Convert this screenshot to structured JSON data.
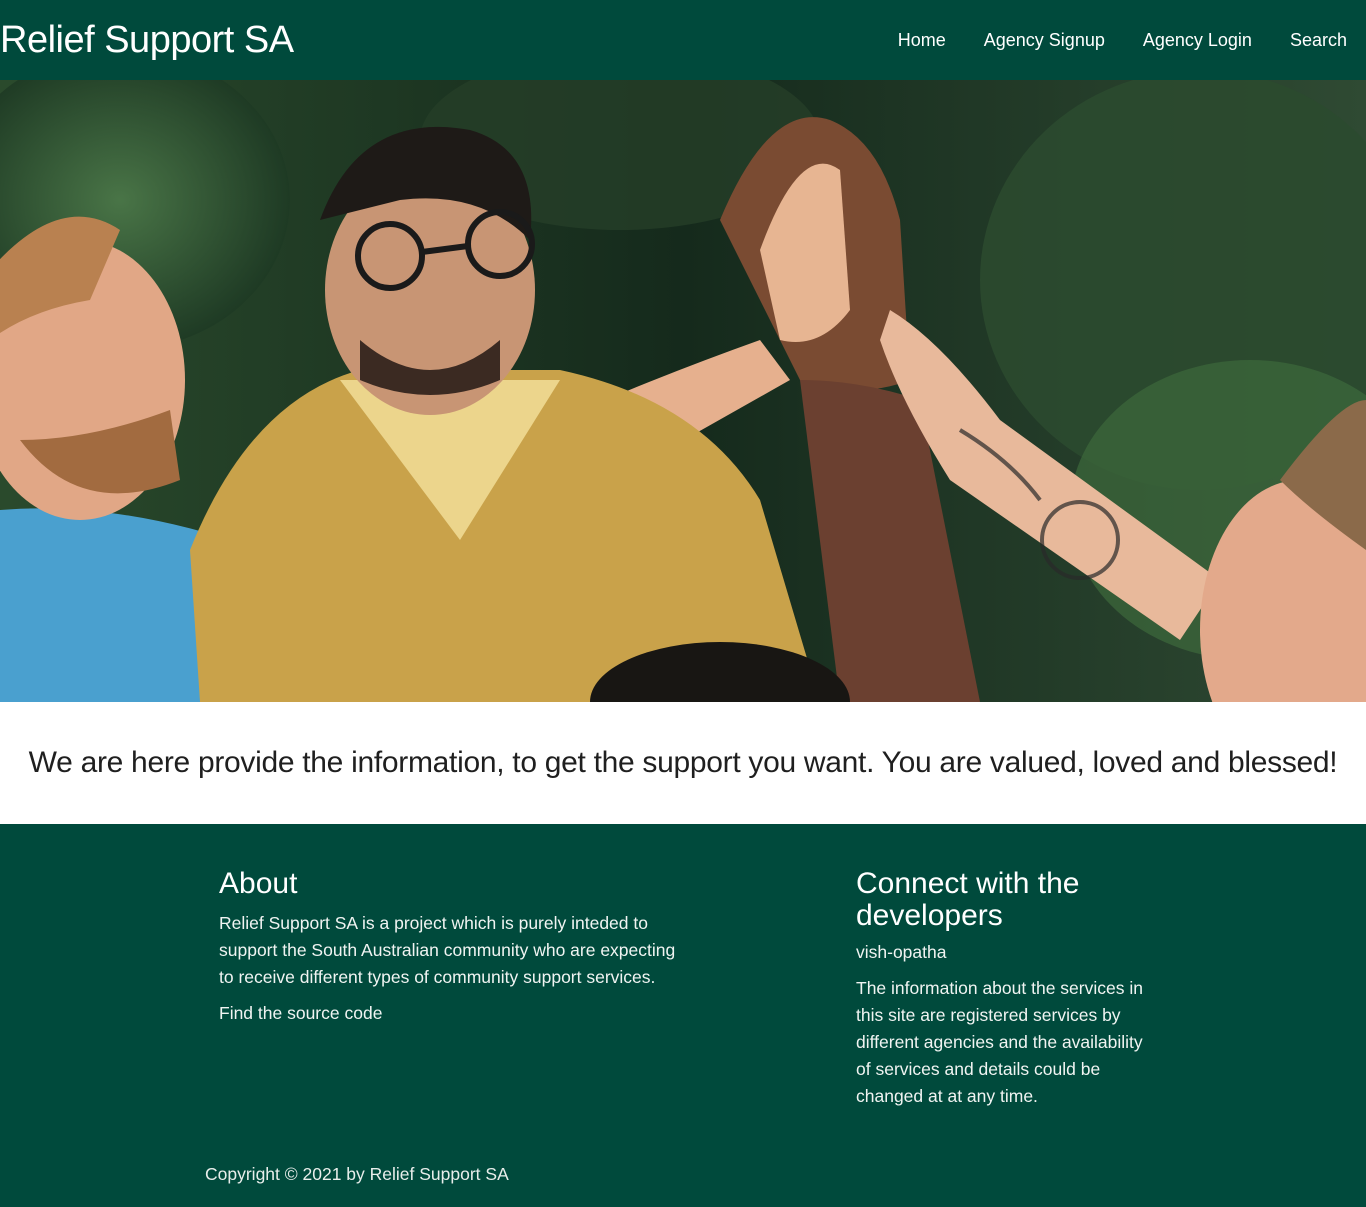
{
  "navbar": {
    "brand": "Relief Support SA",
    "links": [
      {
        "label": "Home"
      },
      {
        "label": "Agency Signup"
      },
      {
        "label": "Agency Login"
      },
      {
        "label": "Search"
      }
    ]
  },
  "tagline": "We are here provide the information, to get the support you want. You are valued, loved and blessed!",
  "footer": {
    "about": {
      "heading": "About",
      "text": "Relief Support SA is a project which is purely inteded to support the South Australian community who are expecting to receive different types of community support services.",
      "source_link": "Find the source code"
    },
    "connect": {
      "heading": "Connect with the developers",
      "developer": "vish-opatha",
      "text": "The information about the services in this site are registered services by different agencies and the availability of services and details could be changed at at any time."
    },
    "copyright": "Copyright © 2021 by Relief Support SA"
  },
  "colors": {
    "brand_green": "#004a3c",
    "tagline_text": "#1f1f1f"
  }
}
